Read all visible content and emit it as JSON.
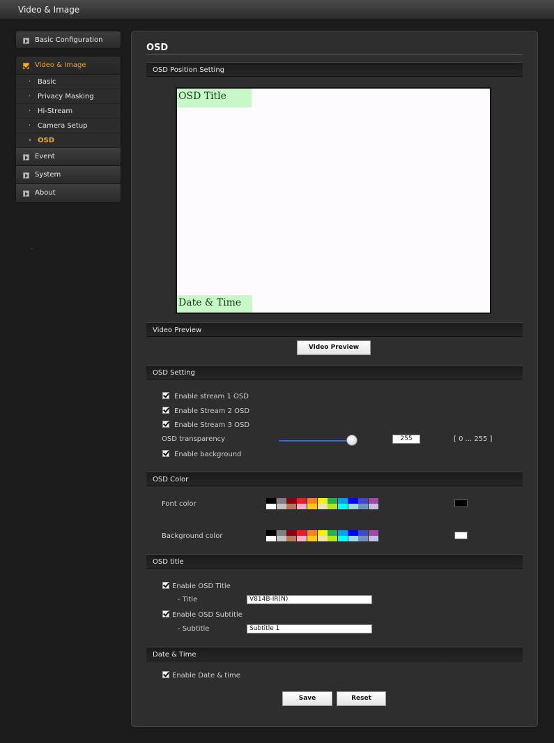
{
  "topbar": {
    "title": "Video & Image"
  },
  "sidebar": {
    "basic_configuration": "Basic Configuration",
    "video_image": "Video & Image",
    "sub_items": [
      "Basic",
      "Privacy Masking",
      "Hi-Stream",
      "Camera Setup",
      "OSD"
    ],
    "event": "Event",
    "system": "System",
    "about": "About"
  },
  "page": {
    "title": "OSD"
  },
  "osd_position": {
    "section": "OSD Position Setting",
    "title_block": "OSD Title",
    "datetime_block": "Date & Time"
  },
  "video_preview": {
    "section": "Video Preview",
    "button": "Video Preview"
  },
  "osd_setting": {
    "section": "OSD Setting",
    "stream1": "Enable stream 1 OSD",
    "stream2": "Enable Stream 2 OSD",
    "stream3": "Enable Stream 3 OSD",
    "transparency_label": "OSD transparency",
    "transparency_value": "255",
    "transparency_level": 1.0,
    "range": "[ 0 ... 255 ]",
    "background": "Enable background"
  },
  "osd_color": {
    "section": "OSD Color",
    "font_label": "Font color",
    "background_label": "Background color",
    "font_selected": "#000000",
    "background_selected": "#ffffff",
    "palette_top": [
      "#000000",
      "#7f7f7f",
      "#880015",
      "#ed1c24",
      "#ff7f27",
      "#fff200",
      "#22b14c",
      "#00a2e8",
      "#0000ff",
      "#3f48cc",
      "#a349a4"
    ],
    "palette_bottom": [
      "#ffffff",
      "#c3c3c3",
      "#b97a57",
      "#ffaec9",
      "#ffc90e",
      "#efe4b0",
      "#b5e61d",
      "#00ffff",
      "#99d9ea",
      "#7092be",
      "#c8bfe7"
    ]
  },
  "osd_title": {
    "section": "OSD title",
    "enable_title": "Enable OSD Title",
    "title_label": "- Title",
    "title_value": "V814B-IR(N)",
    "enable_subtitle": "Enable OSD Subtitle",
    "subtitle_label": "- Subtitle",
    "subtitle_value": "Subtitle 1"
  },
  "date_time": {
    "section": "Date & Time",
    "enable": "Enable Date & time"
  },
  "actions": {
    "save": "Save",
    "reset": "Reset"
  }
}
